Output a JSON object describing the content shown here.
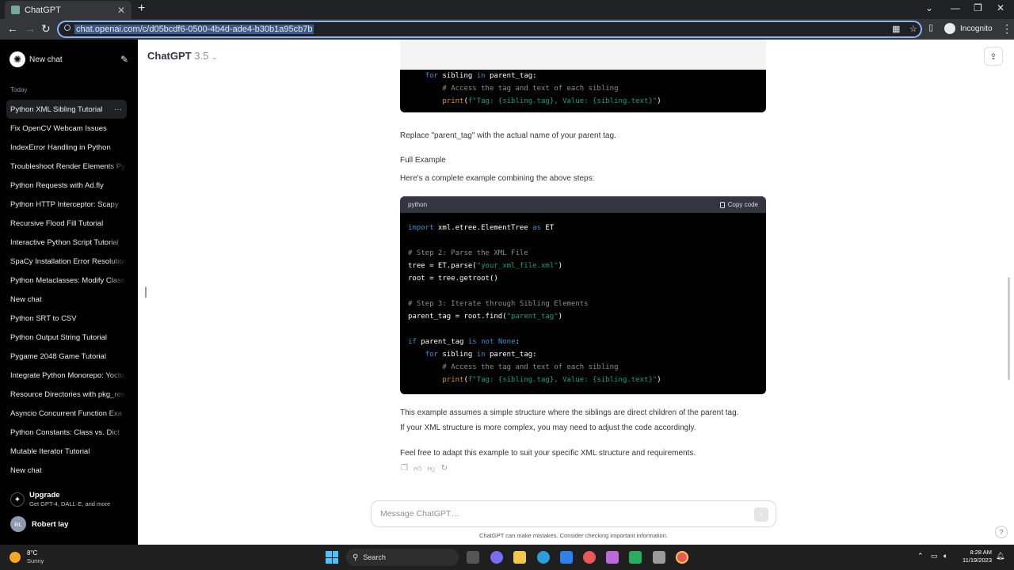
{
  "browser": {
    "tab_title": "ChatGPT",
    "url": "chat.openai.com/c/d05bcdf6-0500-4b4d-ade4-b30b1a95cb7b",
    "incognito_label": "Incognito"
  },
  "sidebar": {
    "new_chat_label": "New chat",
    "section_label": "Today",
    "items": [
      {
        "label": "Python XML Sibling Tutorial",
        "active": true
      },
      {
        "label": "Fix OpenCV Webcam Issues"
      },
      {
        "label": "IndexError Handling in Python"
      },
      {
        "label": "Troubleshoot Render Elements Py"
      },
      {
        "label": "Python Requests with Ad.fly"
      },
      {
        "label": "Python HTTP Interceptor: Scapy"
      },
      {
        "label": "Recursive Flood Fill Tutorial"
      },
      {
        "label": "Interactive Python Script Tutorial"
      },
      {
        "label": "SpaCy Installation Error Resolution"
      },
      {
        "label": "Python Metaclasses: Modify Class"
      },
      {
        "label": "New chat"
      },
      {
        "label": "Python SRT to CSV"
      },
      {
        "label": "Python Output String Tutorial"
      },
      {
        "label": "Pygame 2048 Game Tutorial"
      },
      {
        "label": "Integrate Python Monorepo: Yocto"
      },
      {
        "label": "Resource Directories with pkg_res"
      },
      {
        "label": "Asyncio Concurrent Function Exa"
      },
      {
        "label": "Python Constants: Class vs. Dict"
      },
      {
        "label": "Mutable Iterator Tutorial"
      },
      {
        "label": "New chat"
      }
    ],
    "upgrade_title": "Upgrade",
    "upgrade_sub": "Get GPT-4, DALL·E, and more",
    "user_initials": "RL",
    "user_name": "Robert lay"
  },
  "header": {
    "model_name": "ChatGPT",
    "model_version": "3.5"
  },
  "conversation": {
    "replace_text": "Replace \"parent_tag\" with the actual name of your parent tag.",
    "full_example_heading": "Full Example",
    "intro_text": "Here's a complete example combining the above steps:",
    "code_lang": "python",
    "copy_label": "Copy code",
    "para1_line1": "This example assumes a simple structure where the siblings are direct children of the parent tag.",
    "para1_line2": "If your XML structure is more complex, you may need to adjust the code accordingly.",
    "para2": "Feel free to adapt this example to suit your specific XML structure and requirements."
  },
  "composer": {
    "placeholder": "Message ChatGPT…",
    "disclaimer": "ChatGPT can make mistakes. Consider checking important information."
  },
  "taskbar": {
    "temperature": "8°C",
    "weather": "Sunny",
    "search_label": "Search",
    "time": "8:28 AM",
    "date": "11/19/2023"
  }
}
